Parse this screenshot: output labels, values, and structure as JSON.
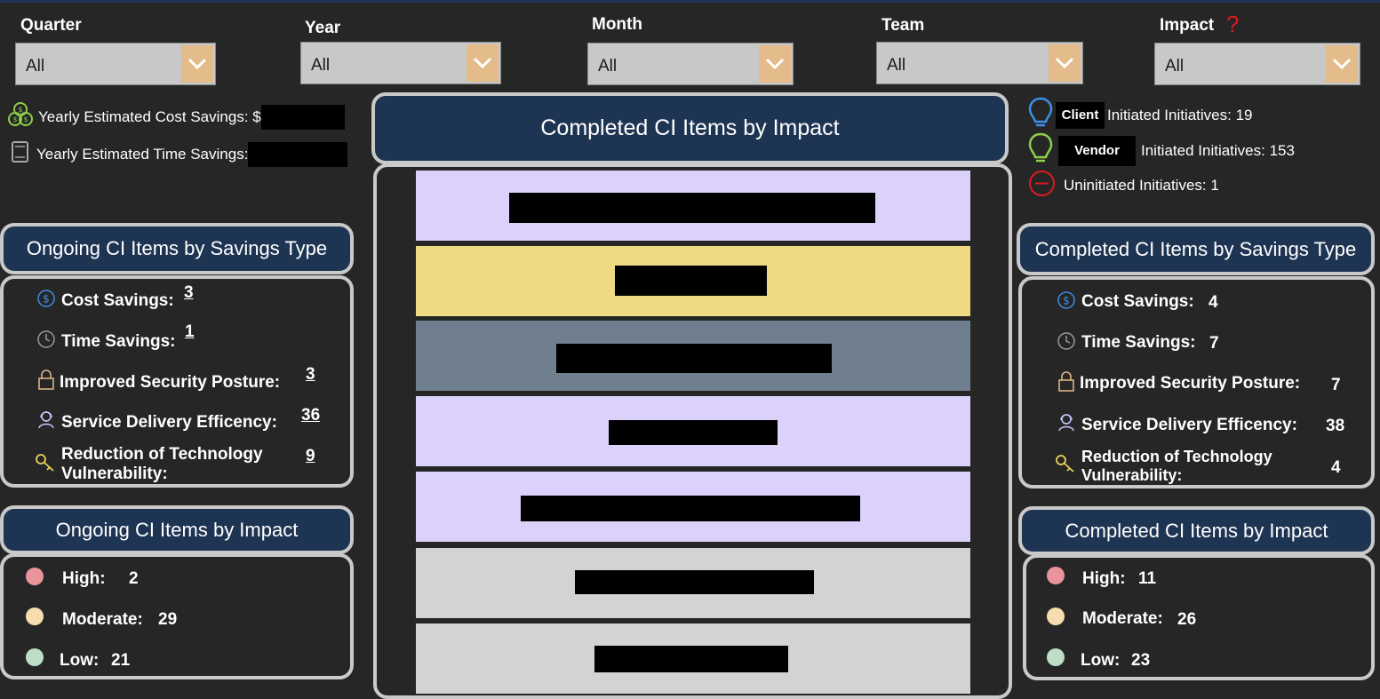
{
  "filters": [
    {
      "label": "Quarter",
      "value": "All"
    },
    {
      "label": "Year",
      "value": "All"
    },
    {
      "label": "Month",
      "value": "All"
    },
    {
      "label": "Team",
      "value": "All"
    },
    {
      "label": "Impact",
      "value": "All"
    }
  ],
  "help_icon_glyph": "?",
  "yearly": {
    "cost_label": "Yearly Estimated Cost Savings: $",
    "time_label": "Yearly Estimated Time Savings:"
  },
  "initiatives": {
    "client_chip": "Client",
    "client_text": "Initiated Initiatives: 19",
    "vendor_chip": "Vendor",
    "vendor_text": "Initiated Initiatives: 153",
    "uninitiated_text": "Uninitiated Initiatives: 1"
  },
  "center_card": {
    "title": "Completed CI Items by Impact",
    "band_colors": [
      "#dcd1fb",
      "#efda83",
      "#6f7f8f",
      "#dcd1fb",
      "#dcd1fb",
      "#d3d3d3",
      "#d3d3d3"
    ]
  },
  "ongoing_savings": {
    "title": "Ongoing CI Items by Savings Type",
    "items": [
      {
        "label": "Cost Savings:",
        "value": "3"
      },
      {
        "label": "Time Savings:",
        "value": "1"
      },
      {
        "label": "Improved Security Posture:",
        "value": "3"
      },
      {
        "label": "Service Delivery Efficency:",
        "value": "36"
      },
      {
        "label": "Reduction of Technology",
        "label2": "Vulnerability:",
        "value": "9"
      }
    ]
  },
  "completed_savings": {
    "title": "Completed CI Items by Savings Type",
    "items": [
      {
        "label": "Cost Savings:",
        "value": "4"
      },
      {
        "label": "Time Savings:",
        "value": "7"
      },
      {
        "label": "Improved Security Posture:",
        "value": "7"
      },
      {
        "label": "Service Delivery Efficency:",
        "value": "38"
      },
      {
        "label": "Reduction of Technology",
        "label2": "Vulnerability:",
        "value": "4"
      }
    ]
  },
  "ongoing_impact": {
    "title": "Ongoing CI Items by Impact",
    "items": [
      {
        "label": "High:",
        "value": "2",
        "color": "#e8949a"
      },
      {
        "label": "Moderate:",
        "value": "29",
        "color": "#f6dcae"
      },
      {
        "label": "Low:",
        "value": "21",
        "color": "#bedfc6"
      }
    ]
  },
  "completed_impact": {
    "title": "Completed CI Items by Impact",
    "items": [
      {
        "label": "High:",
        "value": "11",
        "color": "#e8949a"
      },
      {
        "label": "Moderate:",
        "value": "26",
        "color": "#f6dcae"
      },
      {
        "label": "Low:",
        "value": "23",
        "color": "#bedfc6"
      }
    ]
  }
}
